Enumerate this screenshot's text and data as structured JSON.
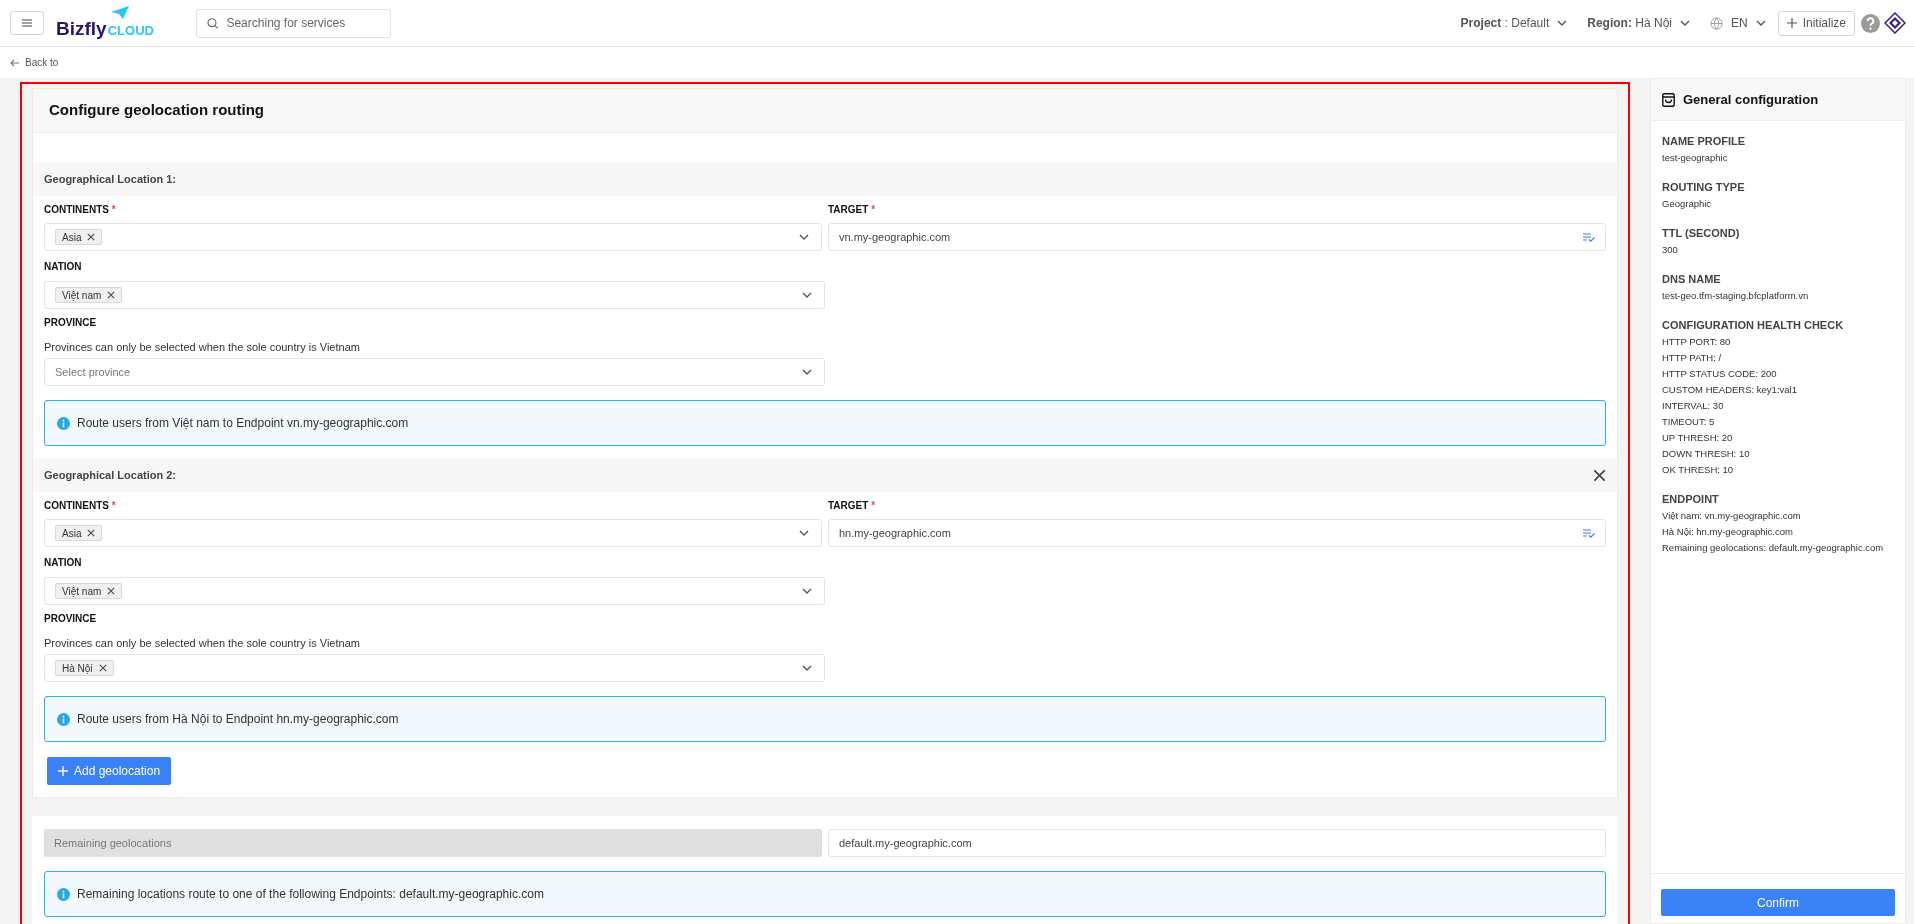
{
  "header": {
    "logo": {
      "word": "Bizfly",
      "sub": "CLOUD"
    },
    "search": {
      "placeholder": "Searching for services"
    },
    "project": "**Project** : Default",
    "region": "**Region:** Hà Nội",
    "language": "EN",
    "initialize_button": "Initialize"
  },
  "back_link": "Back to",
  "form": {
    "title": "Configure geolocation routing",
    "locations": [
      {
        "title": "Geographical Location 1:",
        "removable": false,
        "continents": {
          "label": "CONTINENTS",
          "required_mark": "*",
          "tags": [
            "Asia"
          ]
        },
        "target": {
          "label": "TARGET",
          "required_mark": "*",
          "value": "vn.my-geographic.com"
        },
        "nation": {
          "label": "NATION",
          "tags": [
            "Việt nam"
          ]
        },
        "province": {
          "label": "PROVINCE",
          "hint": "Provinces can only be selected when the sole country is Vietnam",
          "placeholder": "Select province"
        },
        "info": "Route users from Việt nam to Endpoint vn.my-geographic.com"
      },
      {
        "title": "Geographical Location 2:",
        "removable": true,
        "continents": {
          "label": "CONTINENTS",
          "required_mark": "*",
          "tags": [
            "Asia"
          ]
        },
        "target": {
          "label": "TARGET",
          "required_mark": "*",
          "value": "hn.my-geographic.com"
        },
        "nation": {
          "label": "NATION",
          "tags": [
            "Việt nam"
          ]
        },
        "province": {
          "label": "PROVINCE",
          "hint": "Provinces can only be selected when the sole country is Vietnam",
          "tags": [
            "Hà Nội"
          ]
        },
        "info": "Route users from Hà Nội to Endpoint hn.my-geographic.com"
      }
    ],
    "add_button": "Add geolocation",
    "remaining": {
      "label": "Remaining geolocations",
      "value": "default.my-geographic.com",
      "info": "Remaining locations route to one of the following Endpoints: default.my-geographic.com"
    }
  },
  "sidebar": {
    "title": "General configuration",
    "sections": [
      {
        "heading": "NAME PROFILE",
        "lines": [
          "test-geographic"
        ]
      },
      {
        "heading": "ROUTING TYPE",
        "lines": [
          "Geographic"
        ]
      },
      {
        "heading": "TTL (SECOND)",
        "lines": [
          "300"
        ]
      },
      {
        "heading": "DNS NAME",
        "lines": [
          "test-geo.tfm-staging.bfcplatform.vn"
        ]
      },
      {
        "heading": "CONFIGURATION HEALTH CHECK",
        "lines": [
          "HTTP PORT: 80",
          "HTTP PATH: /",
          "HTTP STATUS CODE: 200",
          "CUSTOM HEADERS: key1:val1",
          "INTERVAL: 30",
          "TIMEOUT: 5",
          "UP THRESH: 20",
          "DOWN THRESH: 10",
          "OK THRESH: 10"
        ]
      },
      {
        "heading": "ENDPOINT",
        "lines": [
          "Việt nam: vn.my-geographic.com",
          "Hà Nội: hn.my-geographic.com",
          "Remaining geolocations: default.my-geographic.com"
        ]
      }
    ],
    "confirm_button": "Confirm"
  }
}
